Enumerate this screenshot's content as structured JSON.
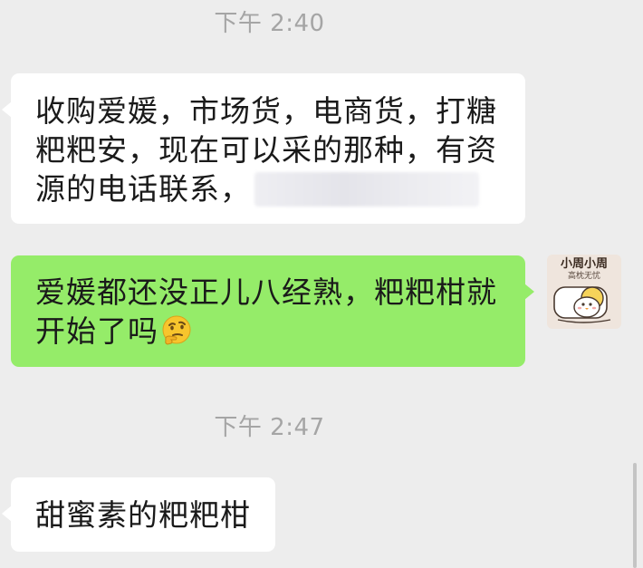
{
  "messages": {
    "time_1": "下午 2:40",
    "msg_1_line_1": "收购爱媛，市场货，电商货，打糖",
    "msg_1_line_2": "粑粑安，现在可以采的那种，有资",
    "msg_1_line_3": "源的电话联系，",
    "msg_2_line_1": "爱媛都还没正儿八经熟，粑粑柑就",
    "msg_2_line_2": "开始了吗",
    "time_2": "下午 2:47",
    "msg_3_line_1": "甜蜜素的粑粑柑"
  },
  "avatar": {
    "title": "小周小周",
    "subtitle": "高枕无忧"
  },
  "icons": {
    "emoji": "thinking-face-emoji"
  },
  "colors": {
    "background": "#ededed",
    "incoming_bubble": "#ffffff",
    "outgoing_bubble": "#95ec69",
    "timestamp_text": "#a5a5a5"
  }
}
